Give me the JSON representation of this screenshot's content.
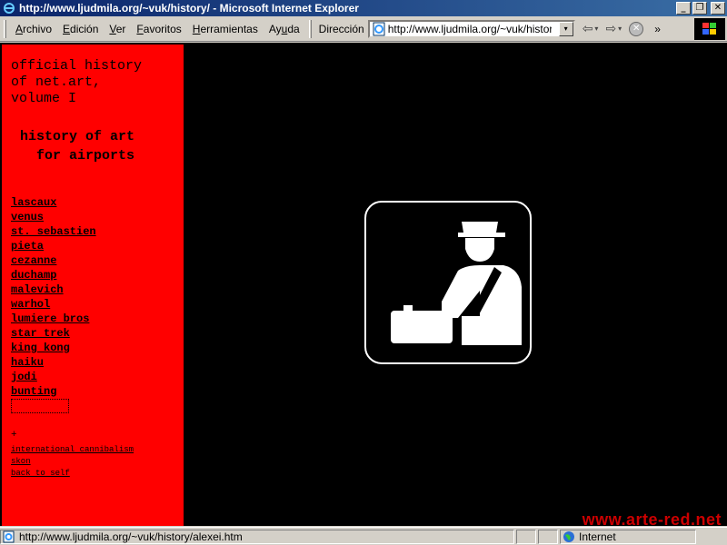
{
  "window": {
    "title": "http://www.ljudmila.org/~vuk/history/ - Microsoft Internet Explorer",
    "min_glyph": "_",
    "max_glyph": "❐",
    "close_glyph": "✕"
  },
  "menu": {
    "items": [
      {
        "u": "A",
        "rest": "rchivo"
      },
      {
        "u": "E",
        "rest": "dición"
      },
      {
        "u": "V",
        "rest": "er"
      },
      {
        "u": "F",
        "rest": "avoritos"
      },
      {
        "u": "H",
        "rest": "erramientas"
      },
      {
        "u": "",
        "rest": "Ay",
        "u2": "u",
        "rest2": "da"
      }
    ],
    "address_label_pre": "Dirección",
    "address_value": "http://www.ljudmila.org/~vuk/history/",
    "back_glyph": "⇦",
    "forward_glyph": "⇨",
    "dropdown_glyph": "▾",
    "stop_glyph": "✕",
    "chevron": "»"
  },
  "sidebar": {
    "heading1": "official history\nof net.art,\nvolume I",
    "heading2": "history of art\n  for airports",
    "links": [
      "lascaux",
      "venus",
      "st. sebastien",
      "pieta",
      "cezanne",
      "duchamp",
      "malevich",
      "warhol",
      "lumiere bros",
      "star trek",
      "king kong",
      "haiku",
      "jodi",
      "bunting"
    ],
    "plus": "+",
    "small_links": [
      "international cannibalism",
      "skon",
      "back to self"
    ]
  },
  "main": {
    "pictogram_icon": "customs-officer-pictogram-icon"
  },
  "statusbar": {
    "url": "http://www.ljudmila.org/~vuk/history/alexei.htm",
    "zone": "Internet"
  },
  "watermark": "www.arte-red.net",
  "colors": {
    "sidebar_bg": "#ff0000",
    "content_bg": "#000000",
    "titlebar": "#0a246a",
    "watermark": "#cc0000"
  }
}
